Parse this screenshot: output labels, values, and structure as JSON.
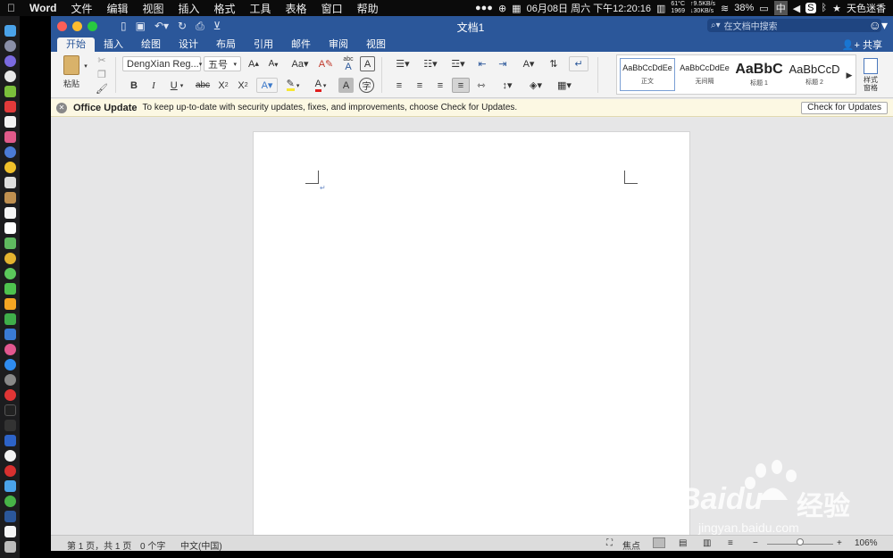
{
  "menubar": {
    "app_name": "Word",
    "menus": [
      "文件",
      "编辑",
      "视图",
      "插入",
      "格式",
      "工具",
      "表格",
      "窗口",
      "帮助"
    ],
    "status": {
      "date_time": "06月08日 周六 下午12:20:16",
      "temp": "61°C",
      "fan": "1969",
      "net_up": "↑9.5KB/s",
      "net_down": "↓30KB/s",
      "battery": "38%",
      "input_method": "中",
      "user": "天色迷香"
    }
  },
  "titlebar": {
    "doc_title": "文档1",
    "search_placeholder": "在文档中搜索"
  },
  "tabs": [
    "开始",
    "插入",
    "绘图",
    "设计",
    "布局",
    "引用",
    "邮件",
    "审阅",
    "视图"
  ],
  "active_tab": "开始",
  "share_label": "共享",
  "ribbon": {
    "paste_label": "粘贴",
    "font_name": "DengXian Reg...",
    "font_size": "五号",
    "bold": "B",
    "italic": "I",
    "underline": "U",
    "strike": "abc",
    "subscript": "X",
    "sub_mark": "2",
    "superscript": "X",
    "sup_mark": "2",
    "abc_label": "abc",
    "styles": [
      {
        "preview": "AaBbCcDdEe",
        "name": "正文"
      },
      {
        "preview": "AaBbCcDdEe",
        "name": "无间隔"
      },
      {
        "preview": "AaBbC",
        "name": "标题 1"
      },
      {
        "preview": "AaBbCcD",
        "name": "标题 2"
      }
    ],
    "style_pane_label_1": "样式",
    "style_pane_label_2": "窗格"
  },
  "notice": {
    "title": "Office Update",
    "message": "To keep up-to-date with security updates, fixes, and improvements, choose Check for Updates.",
    "button": "Check for Updates"
  },
  "statusbar": {
    "page": "第 1 页，共 1 页",
    "words": "0 个字",
    "language": "中文(中国)",
    "focus": "焦点",
    "zoom": "106%",
    "zoom_level": 0.5
  },
  "watermark": {
    "brand": "Baidu",
    "brand_cn": "经验",
    "url": "jingyan.baidu.com"
  },
  "colors": {
    "brand": "#2b579a",
    "notice_bg": "#fcf8e3",
    "highlight": "#f7e733",
    "font_color": "#e01e1e"
  }
}
